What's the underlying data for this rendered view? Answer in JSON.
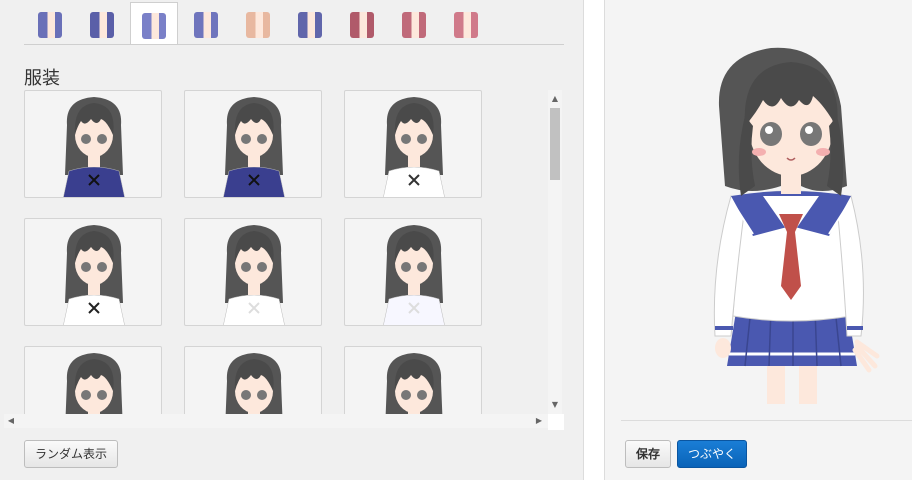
{
  "tabs": [
    {
      "name": "tab-hair-1",
      "color": "#6a70b8",
      "active": false
    },
    {
      "name": "tab-hair-2",
      "color": "#5a5fa8",
      "active": false
    },
    {
      "name": "tab-hair-3",
      "color": "#7a80c8",
      "active": true
    },
    {
      "name": "tab-hair-4",
      "color": "#6f75bd",
      "active": false
    },
    {
      "name": "tab-face-5",
      "color": "#e8b8a0",
      "active": false
    },
    {
      "name": "tab-hair-6",
      "color": "#6166ab",
      "active": false
    },
    {
      "name": "tab-hair-7",
      "color": "#b05a6a",
      "active": false
    },
    {
      "name": "tab-hair-8",
      "color": "#c06a7a",
      "active": false
    },
    {
      "name": "tab-hair-9",
      "color": "#d07a8a",
      "active": false
    }
  ],
  "section_title": "服装",
  "outfits": [
    {
      "name": "outfit-1",
      "top": "#3a3f8f",
      "accent": "#111"
    },
    {
      "name": "outfit-2",
      "top": "#3a3f8f",
      "accent": "#111"
    },
    {
      "name": "outfit-3",
      "top": "#ffffff",
      "accent": "#333"
    },
    {
      "name": "outfit-4",
      "top": "#ffffff",
      "accent": "#222"
    },
    {
      "name": "outfit-5",
      "top": "#ffffff",
      "accent": "#ddd"
    },
    {
      "name": "outfit-6",
      "top": "#f7f7ff",
      "accent": "#ddd"
    },
    {
      "name": "outfit-7",
      "top": "#3a3f8f",
      "accent": "#111"
    },
    {
      "name": "outfit-8",
      "top": "#f0c8b0",
      "accent": "#111"
    },
    {
      "name": "outfit-9",
      "top": "#3a3f8f",
      "accent": "#111"
    }
  ],
  "buttons": {
    "random": "ランダム表示",
    "save": "保存",
    "tweet": "つぶやく"
  },
  "colors": {
    "hair": "#4a4a4a",
    "skin": "#fde8dc",
    "sailor_blue": "#4a58b0",
    "tie_red": "#c0504a",
    "accent_blue": "#0a63b8"
  }
}
